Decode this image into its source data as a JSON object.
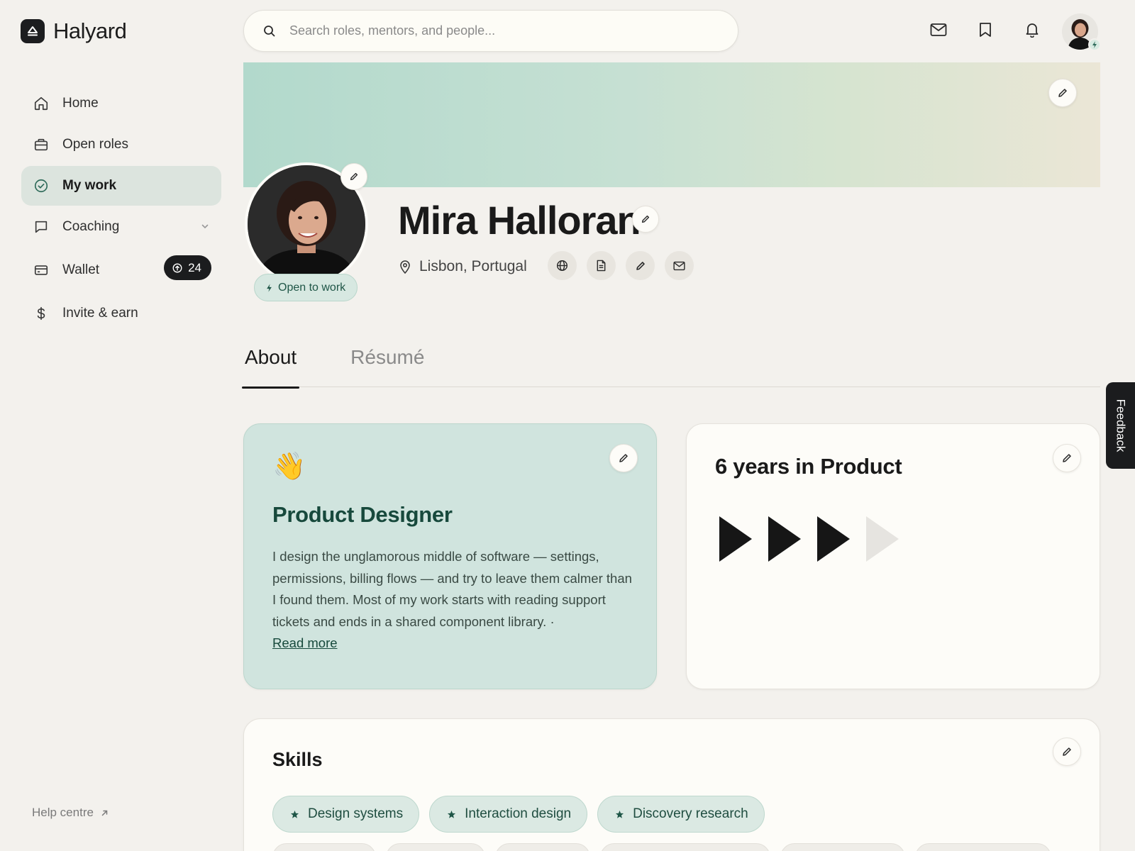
{
  "brand": {
    "name": "Halyard"
  },
  "sidebar": {
    "items": [
      {
        "label": "Home",
        "icon": "home-icon"
      },
      {
        "label": "Open roles",
        "icon": "briefcase-icon"
      },
      {
        "label": "My work",
        "icon": "check-circle-icon",
        "active": true
      },
      {
        "label": "Coaching",
        "icon": "chat-bubble-icon",
        "has_dropdown": true
      },
      {
        "label": "Wallet",
        "icon": "wallet-icon",
        "badge": "24"
      },
      {
        "label": "Invite & earn",
        "icon": "dollar-icon"
      }
    ],
    "help": "Help centre"
  },
  "search": {
    "placeholder": "Search roles, mentors, and people..."
  },
  "topbar": {
    "icons": [
      "mail-icon",
      "bookmark-icon",
      "bell-icon"
    ]
  },
  "profile": {
    "name": "Mira Halloran",
    "status": "Open to work",
    "location": "Lisbon, Portugal",
    "links": [
      "globe-icon",
      "document-icon",
      "pen-icon",
      "mail-icon"
    ]
  },
  "tabs": [
    {
      "label": "About",
      "active": true
    },
    {
      "label": "Résumé",
      "active": false
    }
  ],
  "intro": {
    "emoji": "👋",
    "title": "Product Designer",
    "body": "I design the unglamorous middle of software — settings, permissions, billing flows — and try to leave them calmer than I found them. Most of my work starts with reading support tickets and ends in a shared component library. ·",
    "read_more": "Read more"
  },
  "experience": {
    "title": "6 years in Product",
    "level": 3,
    "level_max": 4
  },
  "skills": {
    "title": "Skills",
    "items": [
      "Design systems",
      "Interaction design",
      "Discovery research"
    ]
  },
  "feedback": {
    "label": "Feedback"
  },
  "colors": {
    "accent": "#2f6b5a",
    "dark": "#1b1c1e",
    "background": "#f3f1ed",
    "intro_card": "#d0e4de"
  }
}
